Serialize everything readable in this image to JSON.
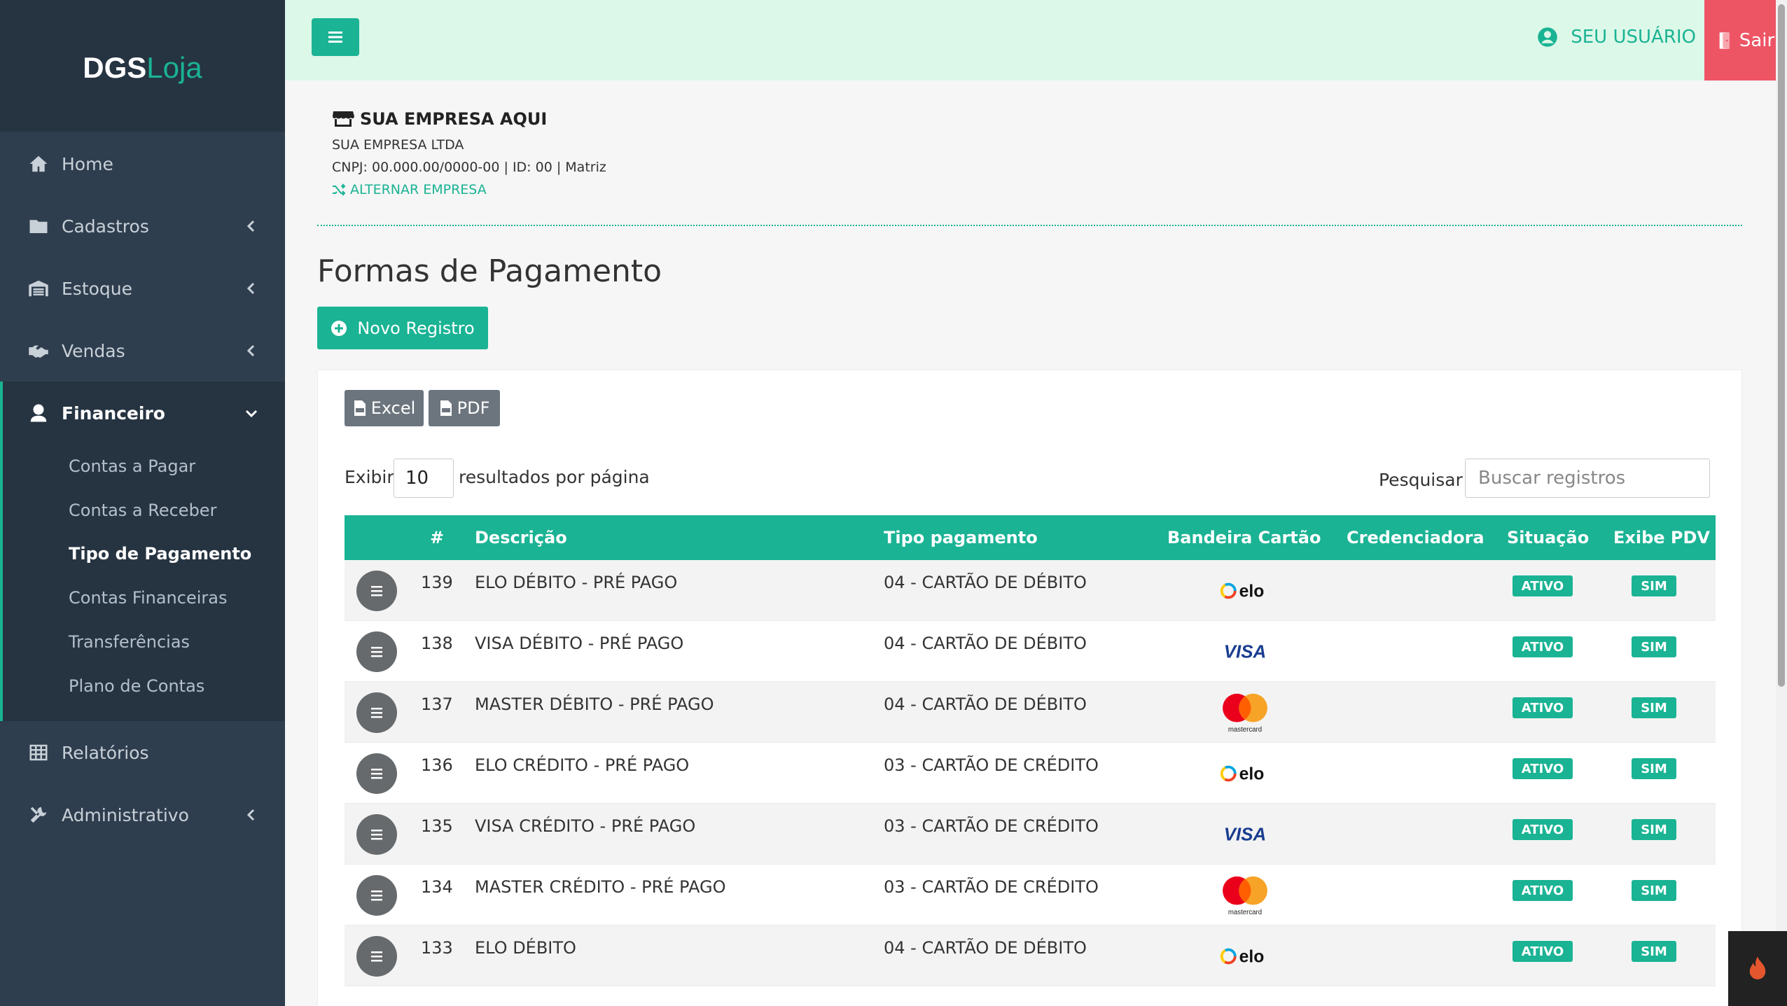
{
  "brand": {
    "part1": "DGS",
    "part2": "Loja",
    "color_accent": "#1ab394"
  },
  "sidebar": {
    "items": [
      {
        "label": "Home",
        "icon": "home-icon"
      },
      {
        "label": "Cadastros",
        "icon": "folder-icon"
      },
      {
        "label": "Estoque",
        "icon": "warehouse-icon"
      },
      {
        "label": "Vendas",
        "icon": "handshake-icon"
      },
      {
        "label": "Financeiro",
        "icon": "money-user-icon"
      },
      {
        "label": "Relatórios",
        "icon": "table-icon"
      },
      {
        "label": "Administrativo",
        "icon": "tools-icon"
      }
    ],
    "financeiro_sub": [
      {
        "label": "Contas a Pagar"
      },
      {
        "label": "Contas a Receber"
      },
      {
        "label": "Tipo de Pagamento"
      },
      {
        "label": "Contas Financeiras"
      },
      {
        "label": "Transferências"
      },
      {
        "label": "Plano de Contas"
      }
    ]
  },
  "topbar": {
    "user_label": "SEU USUÁRIO",
    "logout_label": "Sair"
  },
  "company": {
    "name": "SUA EMPRESA AQUI",
    "legal_name": "SUA EMPRESA LTDA",
    "details": "CNPJ: 00.000.00/0000-00 | ID: 00 | Matriz",
    "switch_label": "ALTERNAR EMPRESA"
  },
  "page": {
    "title": "Formas de Pagamento",
    "new_button": "Novo Registro"
  },
  "toolbar": {
    "excel_label": "Excel",
    "pdf_label": "PDF"
  },
  "listing": {
    "show_label": "Exibir",
    "page_size": "10",
    "per_page_label": "resultados por página",
    "search_label": "Pesquisar",
    "search_placeholder": "Buscar registros"
  },
  "table": {
    "headers": {
      "id": "#",
      "description": "Descrição",
      "type": "Tipo pagamento",
      "brand": "Bandeira Cartão",
      "acquirer": "Credenciadora",
      "status": "Situação",
      "pdv": "Exibe PDV"
    },
    "rows": [
      {
        "id": "139",
        "description": "ELO DÉBITO - PRÉ PAGO",
        "type": "04 - CARTÃO DE DÉBITO",
        "brand": "elo",
        "acquirer": "",
        "status": "ATIVO",
        "pdv": "SIM"
      },
      {
        "id": "138",
        "description": "VISA DÉBITO - PRÉ PAGO",
        "type": "04 - CARTÃO DE DÉBITO",
        "brand": "visa",
        "acquirer": "",
        "status": "ATIVO",
        "pdv": "SIM"
      },
      {
        "id": "137",
        "description": "MASTER DÉBITO - PRÉ PAGO",
        "type": "04 - CARTÃO DE DÉBITO",
        "brand": "mastercard",
        "acquirer": "",
        "status": "ATIVO",
        "pdv": "SIM"
      },
      {
        "id": "136",
        "description": "ELO CRÉDITO - PRÉ PAGO",
        "type": "03 - CARTÃO DE CRÉDITO",
        "brand": "elo",
        "acquirer": "",
        "status": "ATIVO",
        "pdv": "SIM"
      },
      {
        "id": "135",
        "description": "VISA CRÉDITO - PRÉ PAGO",
        "type": "03 - CARTÃO DE CRÉDITO",
        "brand": "visa",
        "acquirer": "",
        "status": "ATIVO",
        "pdv": "SIM"
      },
      {
        "id": "134",
        "description": "MASTER CRÉDITO - PRÉ PAGO",
        "type": "03 - CARTÃO DE CRÉDITO",
        "brand": "mastercard",
        "acquirer": "",
        "status": "ATIVO",
        "pdv": "SIM"
      },
      {
        "id": "133",
        "description": "ELO DÉBITO",
        "type": "04 - CARTÃO DE DÉBITO",
        "brand": "elo",
        "acquirer": "",
        "status": "ATIVO",
        "pdv": "SIM"
      }
    ]
  },
  "logos": {
    "visa": "VISA",
    "elo": "elo",
    "mastercard": "mastercard"
  }
}
